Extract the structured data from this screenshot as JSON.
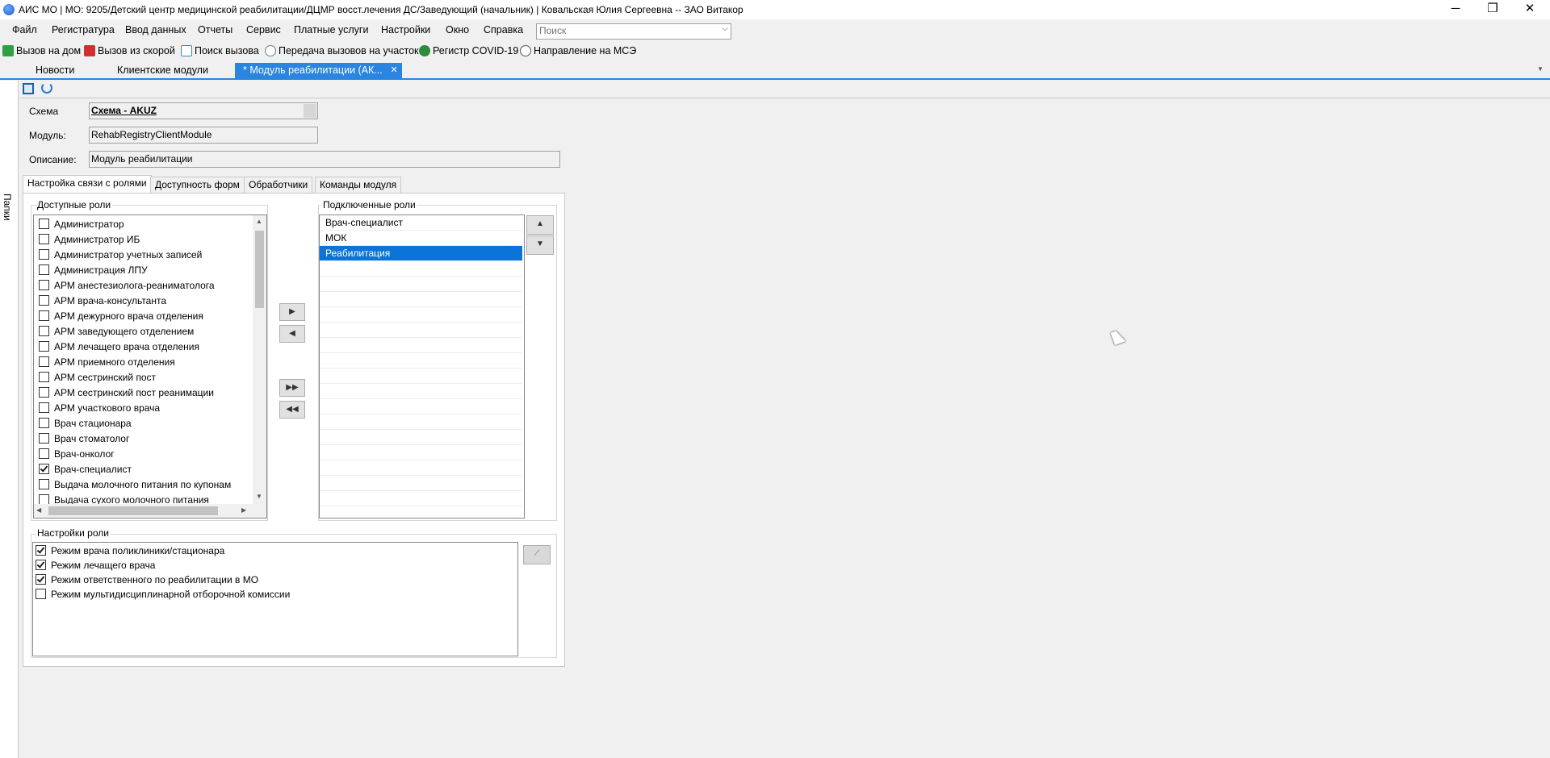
{
  "window": {
    "title": "АИС МО | МО: 9205/Детский центр медицинской реабилитации/ДЦМР восст.лечения ДС/Заведующий (начальник) | Ковальская Юлия Сергеевна -- ЗАО Витакор",
    "minimize": "─",
    "restore": "❐",
    "close": "✕"
  },
  "menu": [
    "Файл",
    "Регистратура",
    "Ввод данных",
    "Отчеты",
    "Сервис",
    "Платные услуги",
    "Настройки",
    "Окно",
    "Справка"
  ],
  "search": {
    "placeholder": "Поиск",
    "arrow": "⌵"
  },
  "toolbar": [
    {
      "label": "Вызов на дом",
      "icon": "home-call-icon",
      "color": "#2ea043"
    },
    {
      "label": "Вызов из скорой",
      "icon": "ambulance-call-icon",
      "color": "#d03030"
    },
    {
      "label": "Поиск вызова",
      "icon": "search-call-icon",
      "color": "#3c7fd0"
    },
    {
      "label": "Передача вызовов на участок",
      "icon": "transfer-icon",
      "color": "#6a7a8a"
    },
    {
      "label": "Регистр COVID-19",
      "icon": "virus-icon",
      "color": "#2e8b3a"
    },
    {
      "label": "Направление на МСЭ",
      "icon": "referral-icon",
      "color": "#555555"
    }
  ],
  "tabs": [
    {
      "label": "Новости",
      "active": false
    },
    {
      "label": "Клиентские модули",
      "active": false
    },
    {
      "label": "* Модуль реабилитации (АК...",
      "active": true,
      "close": "✕"
    }
  ],
  "folders_label": "Папки",
  "form": {
    "scheme_label": "Схема",
    "scheme_value": "Схема - AKUZ",
    "module_label": "Модуль:",
    "module_value": "RehabRegistryClientModule",
    "description_label": "Описание:",
    "description_value": "Модуль реабилитации"
  },
  "subtabs": [
    "Настройка связи с ролями",
    "Доступность форм",
    "Обработчики",
    "Команды модуля"
  ],
  "available_roles": {
    "title": "Доступные роли",
    "items": [
      {
        "label": "Администратор",
        "checked": false
      },
      {
        "label": "Администратор ИБ",
        "checked": false
      },
      {
        "label": "Администратор учетных записей",
        "checked": false
      },
      {
        "label": "Администрация ЛПУ",
        "checked": false
      },
      {
        "label": "АРМ анестезиолога-реаниматолога",
        "checked": false
      },
      {
        "label": "АРМ врача-консультанта",
        "checked": false
      },
      {
        "label": "АРМ дежурного врача отделения",
        "checked": false
      },
      {
        "label": "АРМ заведующего отделением",
        "checked": false
      },
      {
        "label": "АРМ лечащего врача отделения",
        "checked": false
      },
      {
        "label": "АРМ приемного отделения",
        "checked": false
      },
      {
        "label": "АРМ сестринский пост",
        "checked": false
      },
      {
        "label": "АРМ сестринский пост реанимации",
        "checked": false
      },
      {
        "label": "АРМ участкового врача",
        "checked": false
      },
      {
        "label": "Врач стационара",
        "checked": false
      },
      {
        "label": "Врач стоматолог",
        "checked": false
      },
      {
        "label": "Врач-онколог",
        "checked": false
      },
      {
        "label": "Врач-специалист",
        "checked": true
      },
      {
        "label": "Выдача молочного питания по купонам",
        "checked": false
      },
      {
        "label": "Выдача сухого молочного питания",
        "checked": false
      }
    ]
  },
  "connected_roles": {
    "title": "Подключенные роли",
    "items": [
      "Врач-специалист",
      "МОК",
      "Реабилитация"
    ],
    "selected_index": 2
  },
  "role_settings": {
    "title": "Настройки роли",
    "items": [
      {
        "label": "Режим врача поликлиники/стационара",
        "checked": true
      },
      {
        "label": "Режим лечащего врача",
        "checked": true
      },
      {
        "label": "Режим ответственного по реабилитации в МО",
        "checked": true
      },
      {
        "label": "Режим мультидисциплинарной отборочной комиссии",
        "checked": false
      }
    ]
  },
  "colors": {
    "accent": "#2a85e0",
    "selection": "#0a74d8"
  }
}
